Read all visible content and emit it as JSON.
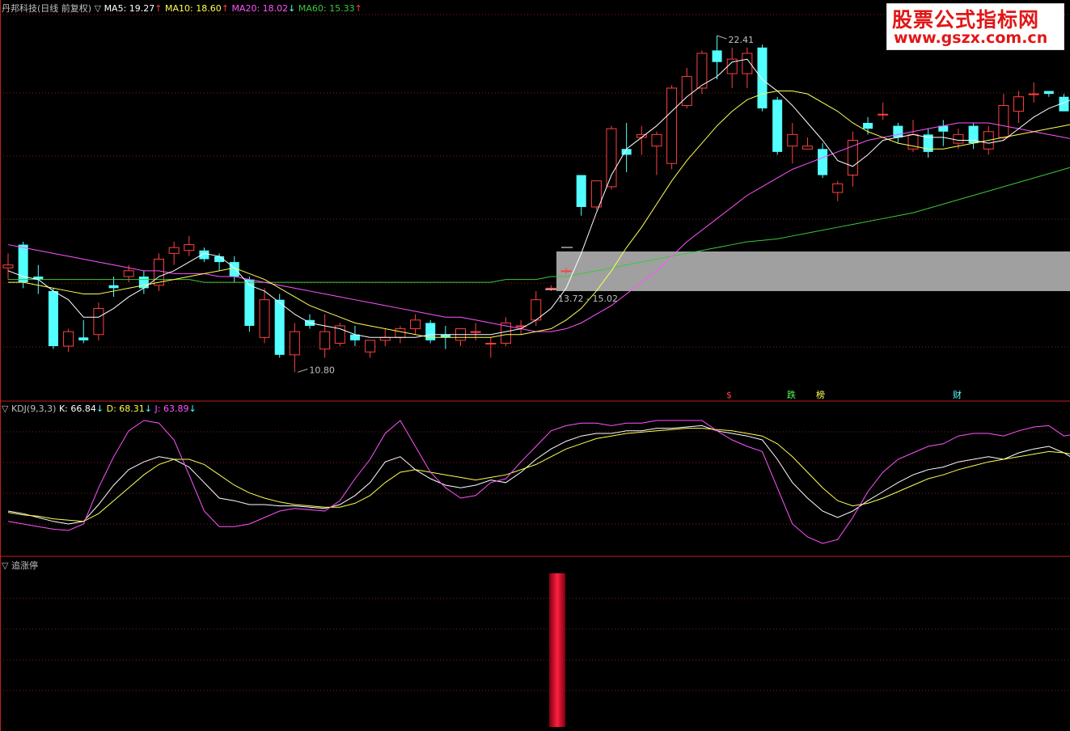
{
  "header": {
    "stock_name": "丹邦科技(日线 前复权)",
    "ma5": "MA5: 19.27",
    "ma10": "MA10: 18.60",
    "ma20": "MA20: 18.02",
    "ma60": "MA60: 15.33",
    "kdj_name": "KDJ(9,3,3)",
    "k": "K: 66.84",
    "d": "D: 68.31",
    "j": "J: 63.89",
    "pane3_name": "追涨停",
    "triangle": "▽"
  },
  "annotations": {
    "high": "22.41",
    "low": "10.80",
    "range": "13.72 - 15.02",
    "events": [
      "$",
      "跌",
      "榜",
      "财"
    ]
  },
  "watermark": {
    "line1": "股票公式指标网",
    "line2": "www.gszx.com.cn"
  },
  "colors": {
    "up": "#ff4040",
    "down": "#54ffff",
    "ma5": "#ffffff",
    "ma10": "#ffff54",
    "ma20": "#ff54ff",
    "ma60": "#3cc83c",
    "grid": "#802020",
    "band": "#a0a0a0"
  },
  "chart_data": [
    {
      "type": "candlestick",
      "title": "丹邦科技(日线 前复权)",
      "candles": [
        {
          "o": 14.4,
          "h": 14.9,
          "l": 14.0,
          "c": 14.5
        },
        {
          "o": 15.2,
          "h": 15.3,
          "l": 13.7,
          "c": 13.9
        },
        {
          "o": 14.1,
          "h": 14.5,
          "l": 13.5,
          "c": 14.0
        },
        {
          "o": 13.6,
          "h": 13.7,
          "l": 11.6,
          "c": 11.7
        },
        {
          "o": 11.7,
          "h": 12.3,
          "l": 11.5,
          "c": 12.2
        },
        {
          "o": 12.0,
          "h": 12.6,
          "l": 11.8,
          "c": 11.9
        },
        {
          "o": 12.1,
          "h": 13.2,
          "l": 11.9,
          "c": 13.0
        },
        {
          "o": 13.8,
          "h": 14.1,
          "l": 13.4,
          "c": 13.7
        },
        {
          "o": 14.1,
          "h": 14.5,
          "l": 13.9,
          "c": 14.3
        },
        {
          "o": 14.1,
          "h": 14.3,
          "l": 13.5,
          "c": 13.7
        },
        {
          "o": 13.8,
          "h": 14.9,
          "l": 13.6,
          "c": 14.7
        },
        {
          "o": 14.9,
          "h": 15.3,
          "l": 14.5,
          "c": 15.1
        },
        {
          "o": 15.0,
          "h": 15.5,
          "l": 14.8,
          "c": 15.2
        },
        {
          "o": 15.0,
          "h": 15.1,
          "l": 14.6,
          "c": 14.7
        },
        {
          "o": 14.8,
          "h": 14.9,
          "l": 14.3,
          "c": 14.6
        },
        {
          "o": 14.6,
          "h": 14.8,
          "l": 13.9,
          "c": 14.1
        },
        {
          "o": 14.0,
          "h": 14.1,
          "l": 12.2,
          "c": 12.4
        },
        {
          "o": 12.0,
          "h": 13.7,
          "l": 11.8,
          "c": 13.3
        },
        {
          "o": 13.3,
          "h": 13.5,
          "l": 11.3,
          "c": 11.4
        },
        {
          "o": 11.4,
          "h": 12.5,
          "l": 10.8,
          "c": 12.2
        },
        {
          "o": 12.6,
          "h": 12.8,
          "l": 12.3,
          "c": 12.4
        },
        {
          "o": 11.6,
          "h": 12.8,
          "l": 11.3,
          "c": 12.2
        },
        {
          "o": 11.8,
          "h": 12.5,
          "l": 11.7,
          "c": 12.4
        },
        {
          "o": 12.1,
          "h": 12.4,
          "l": 11.7,
          "c": 11.9
        },
        {
          "o": 11.5,
          "h": 11.9,
          "l": 11.3,
          "c": 11.9
        },
        {
          "o": 11.9,
          "h": 12.3,
          "l": 11.7,
          "c": 12.0
        },
        {
          "o": 12.0,
          "h": 12.4,
          "l": 11.8,
          "c": 12.3
        },
        {
          "o": 12.3,
          "h": 12.8,
          "l": 12.1,
          "c": 12.6
        },
        {
          "o": 12.5,
          "h": 12.6,
          "l": 11.8,
          "c": 11.9
        },
        {
          "o": 12.1,
          "h": 12.4,
          "l": 11.6,
          "c": 12.0
        },
        {
          "o": 11.9,
          "h": 12.3,
          "l": 11.7,
          "c": 12.3
        },
        {
          "o": 12.2,
          "h": 12.5,
          "l": 11.9,
          "c": 12.2
        },
        {
          "o": 11.8,
          "h": 12.0,
          "l": 11.3,
          "c": 11.8
        },
        {
          "o": 11.8,
          "h": 12.7,
          "l": 11.7,
          "c": 12.5
        },
        {
          "o": 12.4,
          "h": 12.6,
          "l": 12.1,
          "c": 12.4
        },
        {
          "o": 12.6,
          "h": 13.6,
          "l": 12.4,
          "c": 13.3
        },
        {
          "o": 13.7,
          "h": 13.8,
          "l": 13.6,
          "c": 13.7
        },
        {
          "o": 14.3,
          "h": 14.4,
          "l": 14.2,
          "c": 14.3
        },
        {
          "o": 17.6,
          "h": 17.6,
          "l": 16.2,
          "c": 16.5
        },
        {
          "o": 16.5,
          "h": 17.3,
          "l": 16.4,
          "c": 17.4
        },
        {
          "o": 17.2,
          "h": 19.3,
          "l": 17.1,
          "c": 19.2
        },
        {
          "o": 18.5,
          "h": 19.4,
          "l": 17.7,
          "c": 18.3
        },
        {
          "o": 18.9,
          "h": 19.3,
          "l": 18.3,
          "c": 19.0
        },
        {
          "o": 18.6,
          "h": 19.1,
          "l": 17.6,
          "c": 19.0
        },
        {
          "o": 18.0,
          "h": 20.7,
          "l": 17.8,
          "c": 20.6
        },
        {
          "o": 20.0,
          "h": 21.3,
          "l": 19.9,
          "c": 21.0
        },
        {
          "o": 20.6,
          "h": 21.9,
          "l": 20.4,
          "c": 21.8
        },
        {
          "o": 21.9,
          "h": 22.41,
          "l": 20.9,
          "c": 21.5
        },
        {
          "o": 21.1,
          "h": 22.0,
          "l": 20.6,
          "c": 21.6
        },
        {
          "o": 21.1,
          "h": 22.0,
          "l": 20.6,
          "c": 21.8
        },
        {
          "o": 22.0,
          "h": 22.1,
          "l": 19.8,
          "c": 19.9
        },
        {
          "o": 20.2,
          "h": 20.3,
          "l": 18.3,
          "c": 18.4
        },
        {
          "o": 18.6,
          "h": 19.4,
          "l": 18.0,
          "c": 19.0
        },
        {
          "o": 18.5,
          "h": 18.9,
          "l": 18.5,
          "c": 18.6
        },
        {
          "o": 18.5,
          "h": 18.7,
          "l": 17.5,
          "c": 17.6
        },
        {
          "o": 17.0,
          "h": 17.4,
          "l": 16.7,
          "c": 17.3
        },
        {
          "o": 17.6,
          "h": 19.1,
          "l": 17.2,
          "c": 18.8
        },
        {
          "o": 19.4,
          "h": 19.6,
          "l": 19.0,
          "c": 19.2
        },
        {
          "o": 19.7,
          "h": 20.1,
          "l": 19.5,
          "c": 19.7
        },
        {
          "o": 19.3,
          "h": 19.4,
          "l": 18.7,
          "c": 18.9
        },
        {
          "o": 18.5,
          "h": 19.5,
          "l": 18.4,
          "c": 19.0
        },
        {
          "o": 19.0,
          "h": 19.2,
          "l": 18.2,
          "c": 18.4
        },
        {
          "o": 19.3,
          "h": 19.5,
          "l": 18.6,
          "c": 19.1
        },
        {
          "o": 18.7,
          "h": 19.2,
          "l": 18.5,
          "c": 19.0
        },
        {
          "o": 19.3,
          "h": 19.4,
          "l": 18.5,
          "c": 18.7
        },
        {
          "o": 18.5,
          "h": 19.3,
          "l": 18.3,
          "c": 19.1
        },
        {
          "o": 18.9,
          "h": 20.4,
          "l": 18.8,
          "c": 20.0
        },
        {
          "o": 19.8,
          "h": 20.5,
          "l": 19.4,
          "c": 20.3
        },
        {
          "o": 20.4,
          "h": 20.8,
          "l": 20.1,
          "c": 20.4
        },
        {
          "o": 20.5,
          "h": 20.5,
          "l": 20.3,
          "c": 20.4
        },
        {
          "o": 20.3,
          "h": 20.4,
          "l": 19.8,
          "c": 19.8
        },
        {
          "o": 19.7,
          "h": 21.0,
          "l": 19.5,
          "c": 20.9
        }
      ],
      "ma5": [
        14.3,
        14.1,
        14.0,
        13.6,
        13.3,
        12.7,
        12.7,
        13.0,
        13.4,
        13.7,
        14.1,
        14.3,
        14.6,
        14.9,
        14.8,
        14.4,
        13.8,
        13.6,
        13.2,
        12.8,
        12.5,
        12.4,
        12.3,
        12.1,
        12.0,
        12.0,
        12.0,
        12.0,
        12.1,
        12.1,
        12.1,
        12.1,
        12.1,
        12.2,
        12.3,
        12.6,
        13.0,
        13.7,
        14.9,
        16.3,
        17.6,
        18.5,
        18.9,
        19.3,
        19.8,
        20.3,
        20.7,
        21.0,
        21.5,
        21.6,
        20.9,
        20.5,
        20.0,
        19.4,
        18.8,
        18.1,
        17.9,
        18.3,
        18.8,
        18.9,
        19.0,
        18.9,
        18.9,
        18.8,
        18.8,
        18.7,
        18.8,
        19.2,
        19.6,
        19.9,
        20.1,
        20.3
      ],
      "ma10": [
        13.9,
        13.9,
        13.8,
        13.7,
        13.6,
        13.5,
        13.5,
        13.6,
        13.7,
        13.8,
        13.9,
        14.0,
        14.1,
        14.2,
        14.3,
        14.4,
        14.2,
        14.0,
        13.7,
        13.4,
        13.1,
        12.9,
        12.7,
        12.5,
        12.4,
        12.3,
        12.2,
        12.1,
        12.0,
        12.0,
        12.0,
        12.0,
        12.0,
        12.1,
        12.1,
        12.2,
        12.3,
        12.6,
        13.0,
        13.6,
        14.3,
        15.1,
        15.8,
        16.6,
        17.4,
        18.1,
        18.7,
        19.3,
        19.8,
        20.2,
        20.4,
        20.5,
        20.5,
        20.4,
        20.1,
        19.8,
        19.4,
        19.1,
        18.9,
        18.7,
        18.6,
        18.5,
        18.5,
        18.6,
        18.7,
        18.8,
        18.9,
        19.0,
        19.1,
        19.2,
        19.3,
        19.4
      ],
      "ma20": [
        15.2,
        15.1,
        15.0,
        14.9,
        14.8,
        14.7,
        14.6,
        14.5,
        14.4,
        14.3,
        14.3,
        14.2,
        14.2,
        14.2,
        14.1,
        14.1,
        14.0,
        13.9,
        13.8,
        13.7,
        13.6,
        13.5,
        13.4,
        13.3,
        13.2,
        13.1,
        13.0,
        12.9,
        12.8,
        12.7,
        12.7,
        12.6,
        12.5,
        12.4,
        12.3,
        12.2,
        12.2,
        12.3,
        12.5,
        12.8,
        13.1,
        13.5,
        13.9,
        14.3,
        14.8,
        15.3,
        15.7,
        16.1,
        16.5,
        16.9,
        17.2,
        17.5,
        17.8,
        18.0,
        18.2,
        18.4,
        18.6,
        18.8,
        18.9,
        19.0,
        19.1,
        19.2,
        19.3,
        19.4,
        19.4,
        19.4,
        19.3,
        19.2,
        19.1,
        19.0,
        18.9,
        18.8
      ],
      "ma60": [
        14.0,
        14.0,
        14.0,
        14.0,
        14.0,
        14.0,
        14.0,
        14.0,
        14.0,
        14.0,
        14.0,
        14.0,
        14.0,
        13.9,
        13.9,
        13.9,
        13.9,
        13.9,
        13.9,
        13.9,
        13.9,
        13.9,
        13.9,
        13.9,
        13.9,
        13.9,
        13.9,
        13.9,
        13.9,
        13.9,
        13.9,
        13.9,
        13.9,
        14.0,
        14.0,
        14.0,
        14.1,
        14.1,
        14.2,
        14.3,
        14.4,
        14.5,
        14.6,
        14.7,
        14.8,
        14.9,
        15.0,
        15.1,
        15.2,
        15.3,
        15.35,
        15.4,
        15.5,
        15.6,
        15.7,
        15.8,
        15.9,
        16.0,
        16.1,
        16.2,
        16.3,
        16.45,
        16.6,
        16.75,
        16.9,
        17.05,
        17.2,
        17.35,
        17.5,
        17.65,
        17.8,
        17.95
      ],
      "ylim": [
        10.0,
        23.5
      ]
    },
    {
      "type": "line",
      "title": "KDJ(9,3,3)",
      "series": [
        {
          "name": "K",
          "values": [
            30,
            28,
            25,
            22,
            20,
            22,
            35,
            50,
            62,
            68,
            72,
            70,
            64,
            52,
            40,
            38,
            35,
            35,
            34,
            34,
            33,
            32,
            35,
            42,
            52,
            68,
            72,
            62,
            55,
            50,
            48,
            50,
            54,
            52,
            60,
            70,
            78,
            84,
            88,
            90,
            90,
            92,
            92,
            94,
            94,
            95,
            96,
            92,
            90,
            88,
            85,
            70,
            52,
            40,
            30,
            25,
            30,
            38,
            45,
            52,
            58,
            62,
            64,
            68,
            70,
            72,
            70,
            75,
            78,
            80,
            75,
            68
          ]
        },
        {
          "name": "D",
          "values": [
            29,
            27,
            26,
            24,
            23,
            22,
            28,
            38,
            48,
            58,
            66,
            70,
            70,
            66,
            58,
            50,
            44,
            40,
            37,
            35,
            34,
            33,
            33,
            36,
            42,
            52,
            60,
            62,
            60,
            58,
            56,
            54,
            56,
            58,
            62,
            66,
            72,
            78,
            82,
            86,
            88,
            90,
            91,
            92,
            93,
            94,
            94,
            93,
            92,
            90,
            88,
            82,
            72,
            60,
            48,
            38,
            34,
            36,
            40,
            45,
            50,
            55,
            58,
            62,
            65,
            68,
            70,
            72,
            74,
            76,
            75,
            73
          ]
        },
        {
          "name": "J",
          "values": [
            22,
            20,
            18,
            16,
            15,
            20,
            48,
            72,
            92,
            100,
            98,
            85,
            58,
            30,
            18,
            18,
            20,
            25,
            30,
            32,
            31,
            30,
            38,
            55,
            70,
            90,
            100,
            80,
            60,
            48,
            40,
            42,
            52,
            55,
            68,
            80,
            92,
            96,
            98,
            98,
            96,
            98,
            98,
            100,
            100,
            100,
            100,
            92,
            85,
            80,
            76,
            48,
            20,
            10,
            5,
            8,
            25,
            45,
            60,
            70,
            75,
            80,
            82,
            88,
            90,
            90,
            88,
            92,
            95,
            96,
            88,
            90
          ]
        }
      ],
      "ylim": [
        0,
        105
      ]
    },
    {
      "type": "bar",
      "title": "追涨停",
      "signal_index": 37,
      "values": [
        1
      ]
    }
  ]
}
